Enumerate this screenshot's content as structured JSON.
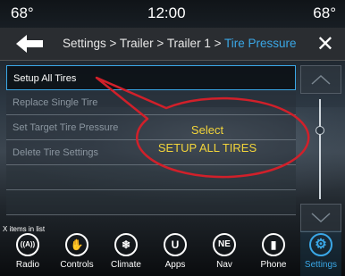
{
  "status": {
    "temp_left": "68°",
    "time": "12:00",
    "temp_right": "68°"
  },
  "header": {
    "breadcrumb_prefix": "Settings > Trailer > Trailer 1 > ",
    "breadcrumb_current": "Tire Pressure"
  },
  "list": {
    "items": [
      {
        "label": "Setup All Tires"
      },
      {
        "label": "Replace Single Tire"
      },
      {
        "label": "Set Target Tire Pressure"
      },
      {
        "label": "Delete Tire Settings"
      }
    ],
    "count_text": "X items in list"
  },
  "callout": {
    "line1": "Select",
    "line2": "SETUP ALL TIRES"
  },
  "dock": {
    "items": [
      {
        "label": "Radio",
        "icon": "radio-icon",
        "glyph": "((A))"
      },
      {
        "label": "Controls",
        "icon": "controls-icon",
        "glyph": "✋"
      },
      {
        "label": "Climate",
        "icon": "climate-icon",
        "glyph": "❄"
      },
      {
        "label": "Apps",
        "icon": "apps-icon",
        "glyph": "U"
      },
      {
        "label": "Nav",
        "icon": "nav-icon",
        "glyph": "NE"
      },
      {
        "label": "Phone",
        "icon": "phone-icon",
        "glyph": "▮"
      },
      {
        "label": "Settings",
        "icon": "settings-icon",
        "glyph": "⚙"
      }
    ]
  },
  "colors": {
    "accent": "#3aa7e6",
    "callout": "#d1202a",
    "callout_text": "#f2d43a"
  }
}
